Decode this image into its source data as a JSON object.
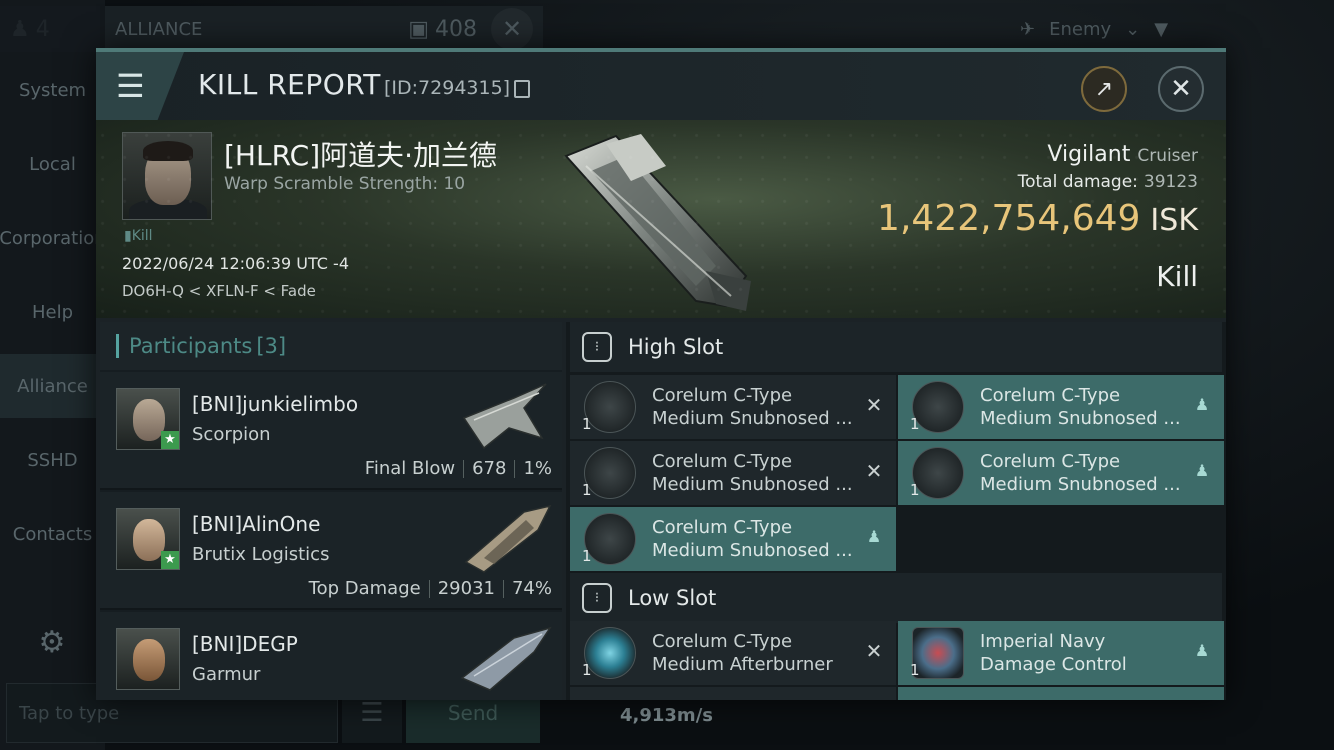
{
  "background": {
    "member_count": "4",
    "channel_title": "ALLIANCE",
    "channel_count": "408",
    "sidebar": [
      {
        "label": "System"
      },
      {
        "label": "Local"
      },
      {
        "label": "Corporation"
      },
      {
        "label": "Help"
      },
      {
        "label": "Alliance"
      },
      {
        "label": "SSHD"
      },
      {
        "label": "Contacts"
      }
    ],
    "chat_placeholder": "Tap to type",
    "send_label": "Send",
    "speed": "4,913m/s",
    "filter_label": "Enemy"
  },
  "report": {
    "title": "KILL REPORT",
    "id": "[ID:7294315]",
    "victim": {
      "name": "[HLRC]阿道夫·加兰德",
      "sub": "Warp Scramble Strength: 10",
      "tag": "Kill",
      "date": "2022/06/24 12:06:39 UTC -4",
      "location": "DO6H-Q < XFLN-F < Fade"
    },
    "ship": {
      "name": "Vigilant",
      "class": "Cruiser",
      "damage_label": "Total damage:",
      "damage_value": "39123",
      "isk_value": "1,422,754,649",
      "isk_unit": "ISK",
      "result": "Kill"
    }
  },
  "participants": {
    "title": "Participants",
    "count": "[3]",
    "rows": [
      {
        "name": "[BNI]junkielimbo",
        "ship": "Scorpion",
        "role": "Final Blow",
        "damage": "678",
        "percent": "1%"
      },
      {
        "name": "[BNI]AlinOne",
        "ship": "Brutix Logistics",
        "role": "Top Damage",
        "damage": "29031",
        "percent": "74%"
      },
      {
        "name": "[BNI]DEGP",
        "ship": "Garmur",
        "role": "",
        "damage": "",
        "percent": ""
      }
    ]
  },
  "fitting": {
    "high_slot": {
      "title": "High Slot",
      "modules": [
        {
          "line1": "Corelum C-Type",
          "line2": "Medium Snubnosed ...",
          "qty": "1",
          "state": "destroyed"
        },
        {
          "line1": "Corelum C-Type",
          "line2": "Medium Snubnosed ...",
          "qty": "1",
          "state": "dropped"
        },
        {
          "line1": "Corelum C-Type",
          "line2": "Medium Snubnosed ...",
          "qty": "1",
          "state": "destroyed"
        },
        {
          "line1": "Corelum C-Type",
          "line2": "Medium Snubnosed ...",
          "qty": "1",
          "state": "dropped"
        },
        {
          "line1": "Corelum C-Type",
          "line2": "Medium Snubnosed ...",
          "qty": "1",
          "state": "dropped"
        }
      ]
    },
    "low_slot": {
      "title": "Low Slot",
      "modules": [
        {
          "line1": "Corelum C-Type",
          "line2": "Medium Afterburner",
          "qty": "1",
          "state": "destroyed"
        },
        {
          "line1": "Imperial Navy",
          "line2": "Damage Control",
          "qty": "1",
          "state": "dropped"
        }
      ]
    }
  }
}
